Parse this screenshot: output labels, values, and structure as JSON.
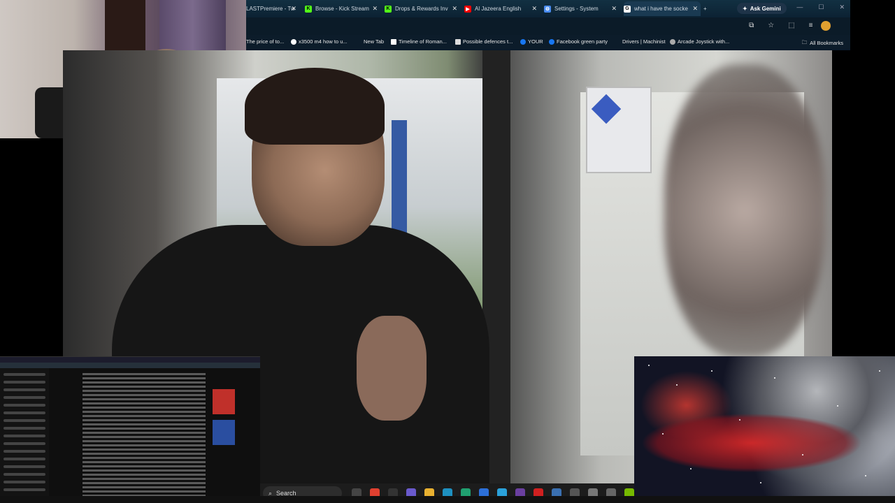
{
  "browser": {
    "tabs": [
      {
        "label": "LASTPremiere - Tw",
        "icon": "generic-tab-icon",
        "color": "#8a8a8a"
      },
      {
        "label": "Browse - Kick Stream",
        "icon": "kick-icon",
        "color": "#53fc18"
      },
      {
        "label": "Drops & Rewards Inv",
        "icon": "kick-icon",
        "color": "#53fc18"
      },
      {
        "label": "Al Jazeera English",
        "icon": "youtube-icon",
        "color": "#ff0000"
      },
      {
        "label": "Settings - System",
        "icon": "gear-icon",
        "color": "#4a8cf0"
      },
      {
        "label": "what i have the socke",
        "icon": "google-icon",
        "color": "#ffffff"
      }
    ],
    "gemini_label": "Ask Gemini",
    "bookmarks": [
      {
        "label": "The price of to...",
        "icon": "bookmark-icon"
      },
      {
        "label": "x3500 m4 how to u...",
        "icon": "google-icon"
      },
      {
        "label": "New Tab",
        "icon": "newtab-icon"
      },
      {
        "label": "Timeline of Roman...",
        "icon": "wikipedia-icon"
      },
      {
        "label": "Possible defences t...",
        "icon": "cl-icon"
      },
      {
        "label": "YOUR",
        "icon": "facebook-icon"
      },
      {
        "label": "Facebook green party",
        "icon": "facebook-icon"
      },
      {
        "label": "Drivers | Machinist",
        "icon": "bookmark-icon"
      },
      {
        "label": "Arcade Joystick with...",
        "icon": "puzzle-icon"
      }
    ],
    "all_bookmarks_label": "All Bookmarks"
  },
  "taskbar": {
    "search_placeholder": "Search",
    "apps": [
      {
        "name": "task-view-icon",
        "color": "#444444"
      },
      {
        "name": "chrome-icon",
        "color": "#e04030"
      },
      {
        "name": "github-icon",
        "color": "#333333"
      },
      {
        "name": "puzzle-icon",
        "color": "#6a5acd"
      },
      {
        "name": "folder-icon",
        "color": "#e8b030"
      },
      {
        "name": "edge-icon",
        "color": "#1e90c0"
      },
      {
        "name": "edge-dev-icon",
        "color": "#20a070"
      },
      {
        "name": "vpn-icon",
        "color": "#2c6fd8"
      },
      {
        "name": "telegram-icon",
        "color": "#2aa1da"
      },
      {
        "name": "app-icon",
        "color": "#6a3fa0"
      },
      {
        "name": "pdf-icon",
        "color": "#d02020"
      },
      {
        "name": "monitor-icon",
        "color": "#3a6fb0"
      },
      {
        "name": "calculator-icon",
        "color": "#555555"
      },
      {
        "name": "settings-icon",
        "color": "#777777"
      },
      {
        "name": "gamepad-icon",
        "color": "#666666"
      },
      {
        "name": "nvidia-icon",
        "color": "#76b900"
      }
    ]
  }
}
